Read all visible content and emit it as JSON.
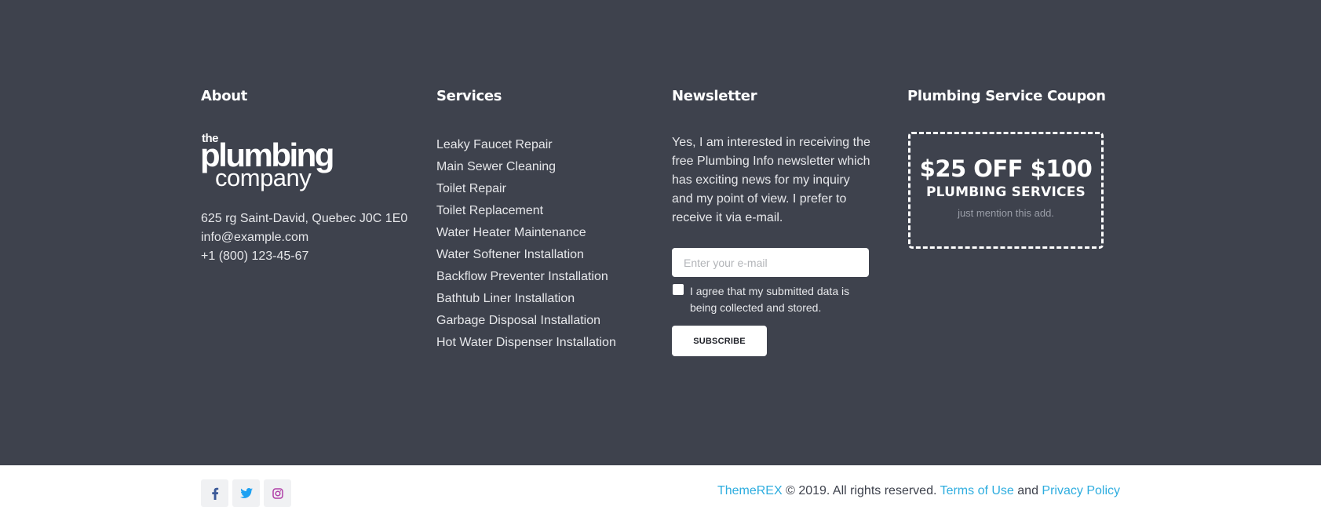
{
  "about": {
    "title": "About",
    "logo": {
      "the": "the",
      "plumbing": "plumbing",
      "company": "company"
    },
    "address": "625 rg Saint-David, Quebec J0C 1E0",
    "email": "info@example.com",
    "phone": "+1 (800) 123-45-67"
  },
  "services": {
    "title": "Services",
    "items": [
      "Leaky Faucet Repair",
      "Main Sewer Cleaning",
      "Toilet Repair",
      "Toilet Replacement",
      "Water Heater Maintenance",
      "Water Softener Installation",
      "Backflow Preventer Installation",
      "Bathtub Liner Installation",
      "Garbage Disposal Installation",
      "Hot Water Dispenser Installation"
    ]
  },
  "newsletter": {
    "title": "Newsletter",
    "text": "Yes, I am interested in receiving the free Plumbing Info newsletter which has exciting news for my inquiry and my point of view. I prefer to receive it via e-mail.",
    "email_placeholder": "Enter your e-mail",
    "email_value": "",
    "agree_text": "I agree that my submitted data is being collected and stored.",
    "subscribe_label": "SUBSCRIBE"
  },
  "coupon": {
    "title": "Plumbing Service Coupon",
    "headline": "$25 OFF $100",
    "subheadline": "PLUMBING SERVICES",
    "note": "just mention this add."
  },
  "bottom": {
    "social": [
      {
        "name": "facebook-icon",
        "color": "#3b5998"
      },
      {
        "name": "twitter-icon",
        "color": "#1da1f2"
      },
      {
        "name": "instagram-icon",
        "color": "#b03fa7"
      }
    ],
    "brand_link": "ThemeREX",
    "copyright_text": " © 2019. All rights reserved. ",
    "terms_link": "Terms of Use",
    "and_text": " and ",
    "privacy_link": "Privacy Policy",
    "link_color": "#2eaddf"
  }
}
